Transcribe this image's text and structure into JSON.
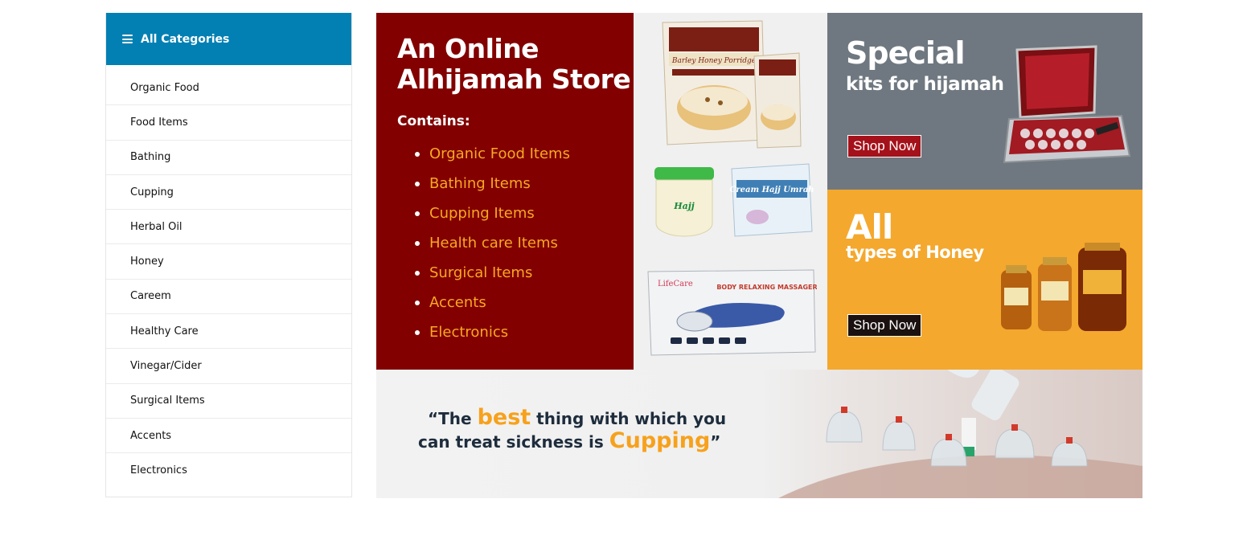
{
  "sidebar": {
    "title": "All Categories",
    "items": [
      "Organic Food",
      "Food Items",
      "Bathing",
      "Cupping",
      "Herbal Oil",
      "Honey",
      "Careem",
      "Healthy Care",
      "Vinegar/Cider",
      "Surgical Items",
      "Accents",
      "Electronics"
    ]
  },
  "promo": {
    "title_line1": "An Online",
    "title_line2": "Alhijamah Store",
    "contains": "Contains:",
    "items": [
      "Organic Food Items",
      "Bathing Items",
      "Cupping Items",
      "Health care Items",
      "Surgical Items",
      "Accents",
      "Electronics"
    ]
  },
  "products": {
    "porridge_box_text": "Barley Honey Porridge",
    "cream_label": "Cream Hajj Umrah",
    "massager_brand": "LifeCare",
    "massager_label": "BODY RELAXING MASSAGER"
  },
  "kits_banner": {
    "headline": "Special",
    "subline": "kits for hijamah",
    "button": "Shop Now"
  },
  "honey_banner": {
    "headline": "All",
    "subline": "types of Honey",
    "button": "Shop Now"
  },
  "cupping_banner": {
    "open_quote": "“The",
    "word1": "best",
    "rest1": "thing with which you",
    "line2": "can treat sickness is",
    "word2": "Cupping",
    "close_quote": "”"
  },
  "colors": {
    "category_header": "#0280b3",
    "promo_bg": "#820000",
    "promo_accent": "#f7a823",
    "kits_bg": "#6f7880",
    "honey_bg": "#f4a82e",
    "kits_button": "#a5111a",
    "honey_button": "#1a1110"
  }
}
